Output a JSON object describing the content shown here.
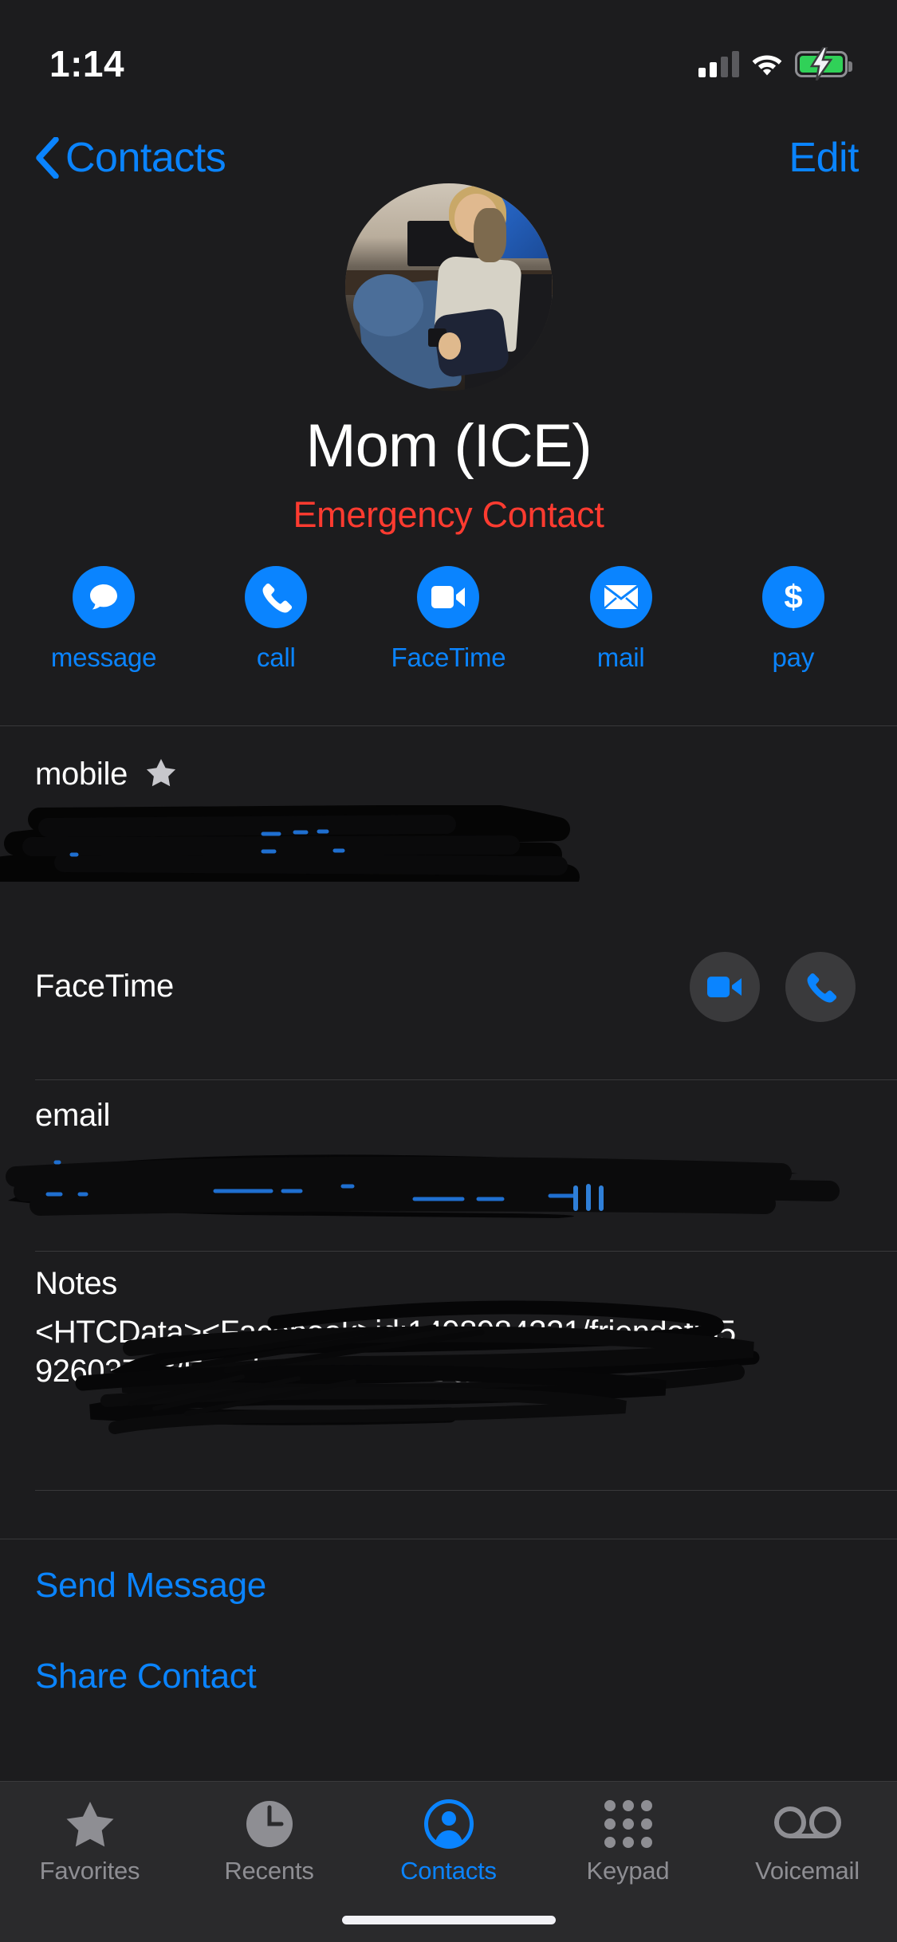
{
  "status_bar": {
    "time": "1:14",
    "cellular_icon": "cellular-bars-icon",
    "cellular_bars_filled": 2,
    "cellular_bars_total": 4,
    "wifi_icon": "wifi-icon",
    "battery_icon": "battery-charging-icon",
    "battery_color": "#30d158",
    "charging": true
  },
  "nav_bar": {
    "back_icon": "chevron-left-icon",
    "back_label": "Contacts",
    "edit_label": "Edit",
    "tint_color": "#0a84ff"
  },
  "contact": {
    "avatar_name": "contact-photo",
    "name": "Mom (ICE)",
    "subtitle": "Emergency Contact",
    "subtitle_color": "#ff3b30"
  },
  "actions": [
    {
      "label": "message",
      "icon": "message-bubble-icon"
    },
    {
      "label": "call",
      "icon": "phone-icon"
    },
    {
      "label": "FaceTime",
      "icon": "video-camera-icon"
    },
    {
      "label": "mail",
      "icon": "envelope-icon"
    },
    {
      "label": "pay",
      "icon": "dollar-sign-icon"
    }
  ],
  "fields": {
    "mobile": {
      "label": "mobile",
      "favorite_icon": "star-icon",
      "value": "",
      "value_redacted": true
    },
    "facetime": {
      "label": "FaceTime",
      "video_icon": "video-camera-icon",
      "audio_icon": "phone-icon"
    },
    "email": {
      "label": "email",
      "value": "",
      "value_redacted": true
    },
    "notes": {
      "label": "Notes",
      "value": "<HTCData><Facebook>id:1498984321/friendof:659260375</Facebook></HTCData>",
      "partially_redacted": true
    }
  },
  "links": [
    {
      "label": "Send Message"
    },
    {
      "label": "Share Contact"
    }
  ],
  "tab_bar": {
    "tabs": [
      {
        "label": "Favorites",
        "icon": "star-icon",
        "active": false
      },
      {
        "label": "Recents",
        "icon": "clock-icon",
        "active": false
      },
      {
        "label": "Contacts",
        "icon": "person-circle-icon",
        "active": true
      },
      {
        "label": "Keypad",
        "icon": "keypad-dots-icon",
        "active": false
      },
      {
        "label": "Voicemail",
        "icon": "voicemail-icon",
        "active": false
      }
    ],
    "active_color": "#0a84ff",
    "inactive_color": "#8e8e93"
  },
  "home_indicator": {
    "name": "home-indicator"
  }
}
